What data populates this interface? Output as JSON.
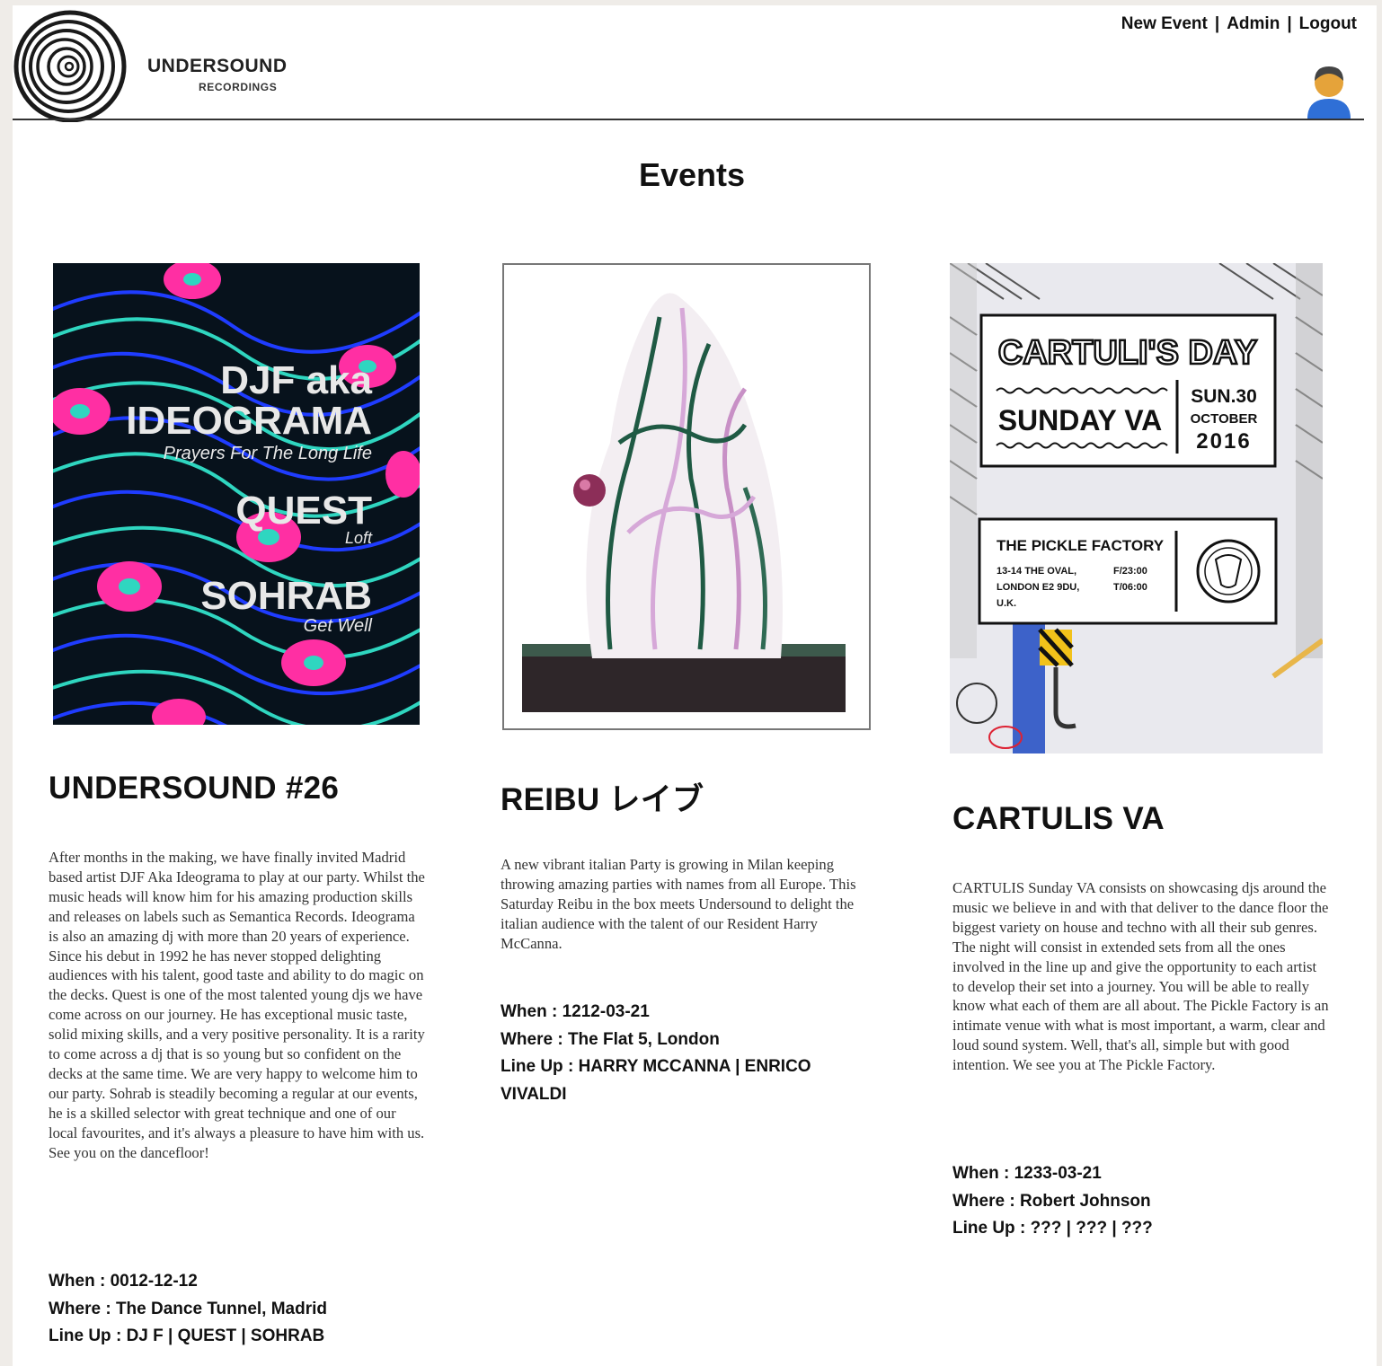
{
  "brand": {
    "name": "UNDERSOUND",
    "sub": "RECORDINGS"
  },
  "nav": {
    "new_event": "New Event",
    "admin": "Admin",
    "logout": "Logout",
    "separator": "|"
  },
  "page": {
    "title": "Events"
  },
  "labels": {
    "when": "When : ",
    "where": "Where : ",
    "lineup": "Line Up : "
  },
  "events": [
    {
      "title": "UNDERSOUND #26",
      "poster": {
        "line1": "DJF aka",
        "line2": "IDEOGRAMA",
        "line3": "Prayers For The Long Life",
        "line4": "QUEST",
        "line5": "Loft",
        "line6": "SOHRAB",
        "line7": "Get Well"
      },
      "description": "After months in the making, we have finally invited Madrid based artist DJF Aka Ideograma to play at our party. Whilst the music heads will know him for his amazing production skills and releases on labels such as Semantica Records. Ideograma is also an amazing dj with more than 20 years of experience. Since his debut in 1992 he has never stopped delighting audiences with his talent, good taste and ability to do magic on the decks. Quest is one of the most talented young djs we have come across on our journey. He has exceptional music taste, solid mixing skills, and a very positive personality. It is a rarity to come across a dj that is so young but so confident on the decks at the same time. We are very happy to welcome him to our party. Sohrab is steadily becoming a regular at our events, he is a skilled selector with great technique and one of our local favourites, and it's always a pleasure to have him with us. See you on the dancefloor!",
      "when": "0012-12-12",
      "where": "The Dance Tunnel, Madrid",
      "lineup": "DJ F | QUEST | SOHRAB"
    },
    {
      "title": "REIBU レイブ",
      "description": "A new vibrant italian Party is growing in Milan keeping throwing amazing parties with names from all Europe. This Saturday Reibu in the box meets Undersound to delight the italian audience with the talent of our Resident Harry McCanna.",
      "when": "1212-03-21",
      "where": "The Flat 5, London",
      "lineup": "HARRY MCCANNA | ENRICO VIVALDI"
    },
    {
      "title": "CARTULIS VA",
      "poster": {
        "title": "CARTULI'S DAY",
        "subtitle": "SUNDAY VA",
        "day": "SUN.30",
        "month": "OCTOBER",
        "year": "2016",
        "venue": "THE PICKLE FACTORY",
        "addr1": "13-14  THE OVAL,",
        "addr2": "LONDON E2 9DU,",
        "addr3": "U.K.",
        "time1": "F/23:00",
        "time2": "T/06:00"
      },
      "description": "CARTULIS Sunday VA consists on showcasing djs around the music we believe in and with that deliver to the dance floor the biggest variety on house and techno with all their sub genres. The night will consist in extended sets from all the ones involved in the line up and give the opportunity to each artist to develop their set into a journey. You will be able to really know what each of them are all about. The Pickle Factory is an intimate venue with what is most important, a warm, clear and loud sound system. Well, that's all, simple but with good intention. We see you at The Pickle Factory.",
      "when": "1233-03-21",
      "where": "Robert Johnson",
      "lineup": "??? | ??? | ???"
    }
  ]
}
